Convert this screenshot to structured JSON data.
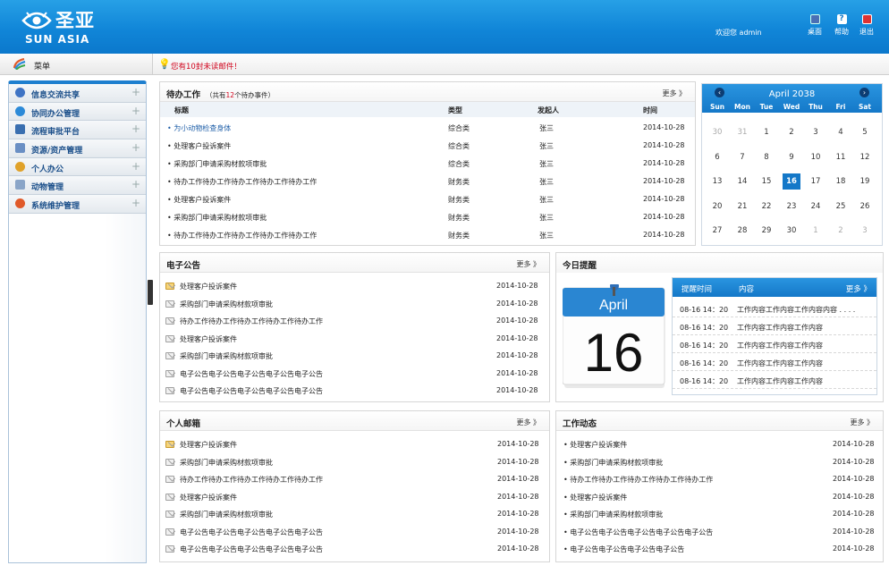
{
  "header": {
    "logo_cn": "圣亚",
    "logo_en": "SUN ASIA",
    "welcome": "欢迎您 admin",
    "buttons": [
      {
        "label": "桌面",
        "icon": "desktop-icon",
        "color": "#4a6fb5"
      },
      {
        "label": "帮助",
        "icon": "help-icon",
        "color": "#ffffff"
      },
      {
        "label": "退出",
        "icon": "exit-icon",
        "color": "#d33"
      }
    ]
  },
  "sidebar": {
    "title": "菜单",
    "items": [
      {
        "label": "信息交流共享",
        "icon": "info-share-icon",
        "color": "#3f74c4"
      },
      {
        "label": "协同办公管理",
        "icon": "collab-office-icon",
        "color": "#2c8ad8"
      },
      {
        "label": "流程审批平台",
        "icon": "workflow-icon",
        "color": "#3a6fb0"
      },
      {
        "label": "资源/资产管理",
        "icon": "asset-icon",
        "color": "#6a8fc4"
      },
      {
        "label": "个人办公",
        "icon": "personal-icon",
        "color": "#e0a22a"
      },
      {
        "label": "动物管理",
        "icon": "animal-icon",
        "color": "#8aa5c8"
      },
      {
        "label": "系统维护管理",
        "icon": "system-icon",
        "color": "#e05a2a"
      }
    ]
  },
  "notice": {
    "prefix": "您有",
    "count": "10",
    "suffix": "封未读邮件！"
  },
  "todo": {
    "title": "待办工作",
    "sub_prefix": "（共有",
    "sub_count": "12",
    "sub_suffix": "个待办事件）",
    "more": "更多 》",
    "columns": [
      "标题",
      "类型",
      "发起人",
      "时间"
    ],
    "rows": [
      {
        "title": "• 为小动物检查身体",
        "type": "综合类",
        "sender": "张三",
        "date": "2014-10-28"
      },
      {
        "title": "• 处理客户投诉案件",
        "type": "综合类",
        "sender": "张三",
        "date": "2014-10-28"
      },
      {
        "title": "• 采购部门申请采购材款项审批",
        "type": "综合类",
        "sender": "张三",
        "date": "2014-10-28"
      },
      {
        "title": "• 待办工作待办工作待办工作待办工作待办工作",
        "type": "财务类",
        "sender": "张三",
        "date": "2014-10-28"
      },
      {
        "title": "• 处理客户投诉案件",
        "type": "财务类",
        "sender": "张三",
        "date": "2014-10-28"
      },
      {
        "title": "• 采购部门申请采购材款项审批",
        "type": "财务类",
        "sender": "张三",
        "date": "2014-10-28"
      },
      {
        "title": "• 待办工作待办工作待办工作待办工作待办工作",
        "type": "财务类",
        "sender": "张三",
        "date": "2014-10-28"
      }
    ]
  },
  "calendar": {
    "title": "April 2038",
    "prev": "‹",
    "next": "›",
    "weekdays": [
      "Sun",
      "Mon",
      "Tue",
      "Wed",
      "Thu",
      "Fri",
      "Sat"
    ],
    "weeks": [
      [
        "30",
        "31",
        "1",
        "2",
        "3",
        "4",
        "5"
      ],
      [
        "6",
        "7",
        "8",
        "9",
        "10",
        "11",
        "12"
      ],
      [
        "13",
        "14",
        "15",
        "16",
        "17",
        "18",
        "19"
      ],
      [
        "20",
        "21",
        "22",
        "23",
        "24",
        "25",
        "26"
      ],
      [
        "27",
        "28",
        "29",
        "30",
        "1",
        "2",
        "3"
      ]
    ],
    "today": "16"
  },
  "announce": {
    "title": "电子公告",
    "more": "更多 》",
    "rows": [
      {
        "title": "处理客户投诉案件",
        "date": "2014-10-28",
        "unread": true
      },
      {
        "title": "采购部门申请采购材款项审批",
        "date": "2014-10-28",
        "unread": false
      },
      {
        "title": "待办工作待办工作待办工作待办工作待办工作",
        "date": "2014-10-28",
        "unread": false
      },
      {
        "title": "处理客户投诉案件",
        "date": "2014-10-28",
        "unread": false
      },
      {
        "title": "采购部门申请采购材款项审批",
        "date": "2014-10-28",
        "unread": false
      },
      {
        "title": "电子公告电子公告电子公告电子公告电子公告",
        "date": "2014-10-28",
        "unread": false
      },
      {
        "title": "电子公告电子公告电子公告电子公告电子公告",
        "date": "2014-10-28",
        "unread": false
      }
    ]
  },
  "reminder": {
    "title": "今日提醒",
    "month": "April",
    "day": "16",
    "col_time": "提醒时间",
    "col_content": "内容",
    "more": "更多 》",
    "rows": [
      {
        "time": "08-16 14：20",
        "content": "工作内容工作内容工作内容内容 . . . ."
      },
      {
        "time": "08-16 14：20",
        "content": "工作内容工作内容工作内容"
      },
      {
        "time": "08-16 14：20",
        "content": "工作内容工作内容工作内容"
      },
      {
        "time": "08-16 14：20",
        "content": "工作内容工作内容工作内容"
      },
      {
        "time": "08-16 14：20",
        "content": "工作内容工作内容工作内容"
      }
    ]
  },
  "mailbox": {
    "title": "个人邮箱",
    "more": "更多 》",
    "rows": [
      {
        "title": "处理客户投诉案件",
        "date": "2014-10-28",
        "unread": true
      },
      {
        "title": "采购部门申请采购材款项审批",
        "date": "2014-10-28",
        "unread": false
      },
      {
        "title": "待办工作待办工作待办工作待办工作待办工作",
        "date": "2014-10-28",
        "unread": false
      },
      {
        "title": "处理客户投诉案件",
        "date": "2014-10-28",
        "unread": false
      },
      {
        "title": "采购部门申请采购材款项审批",
        "date": "2014-10-28",
        "unread": false
      },
      {
        "title": "电子公告电子公告电子公告电子公告电子公告",
        "date": "2014-10-28",
        "unread": false
      },
      {
        "title": "电子公告电子公告电子公告电子公告电子公告",
        "date": "2014-10-28",
        "unread": false
      }
    ]
  },
  "activity": {
    "title": "工作动态",
    "more": "更多 》",
    "rows": [
      {
        "title": "• 处理客户投诉案件",
        "date": "2014-10-28"
      },
      {
        "title": "• 采购部门申请采购材款项审批",
        "date": "2014-10-28"
      },
      {
        "title": "• 待办工作待办工作待办工作待办工作待办工作",
        "date": "2014-10-28"
      },
      {
        "title": "• 处理客户投诉案件",
        "date": "2014-10-28"
      },
      {
        "title": "• 采购部门申请采购材款项审批",
        "date": "2014-10-28"
      },
      {
        "title": "• 电子公告电子公告电子公告电子公告电子公告",
        "date": "2014-10-28"
      },
      {
        "title": "• 电子公告电子公告电子公告电子公告",
        "date": "2014-10-28"
      }
    ]
  }
}
